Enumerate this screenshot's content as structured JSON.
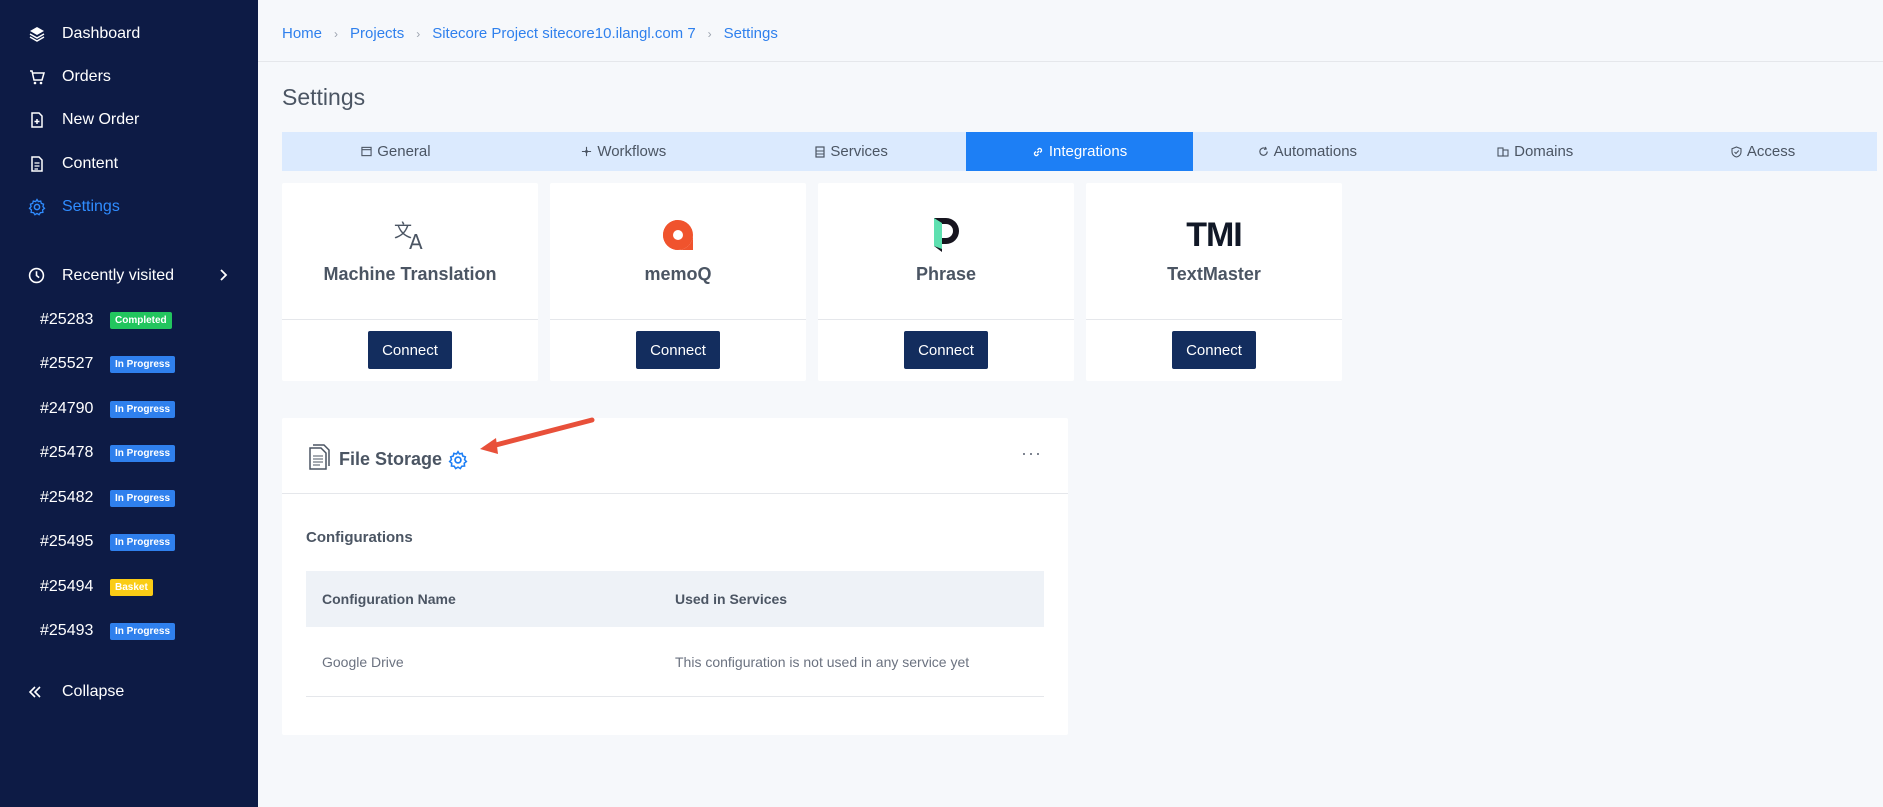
{
  "sidebar": {
    "nav": [
      {
        "label": "Dashboard",
        "icon": "layers-icon"
      },
      {
        "label": "Orders",
        "icon": "cart-icon"
      },
      {
        "label": "New Order",
        "icon": "new-document-icon"
      },
      {
        "label": "Content",
        "icon": "document-icon"
      },
      {
        "label": "Settings",
        "icon": "gear-icon"
      }
    ],
    "recent_label": "Recently visited",
    "recent": [
      {
        "num": "#25283",
        "status": "Completed"
      },
      {
        "num": "#25527",
        "status": "In Progress"
      },
      {
        "num": "#24790",
        "status": "In Progress"
      },
      {
        "num": "#25478",
        "status": "In Progress"
      },
      {
        "num": "#25482",
        "status": "In Progress"
      },
      {
        "num": "#25495",
        "status": "In Progress"
      },
      {
        "num": "#25494",
        "status": "Basket"
      },
      {
        "num": "#25493",
        "status": "In Progress"
      }
    ],
    "collapse_label": "Collapse"
  },
  "breadcrumb": [
    "Home",
    "Projects",
    "Sitecore Project sitecore10.ilangl.com 7",
    "Settings"
  ],
  "page_title": "Settings",
  "tabs": [
    {
      "label": "General",
      "icon": "window-icon"
    },
    {
      "label": "Workflows",
      "icon": "workflow-icon"
    },
    {
      "label": "Services",
      "icon": "server-icon"
    },
    {
      "label": "Integrations",
      "icon": "link-icon",
      "active": true
    },
    {
      "label": "Automations",
      "icon": "refresh-icon"
    },
    {
      "label": "Domains",
      "icon": "building-icon"
    },
    {
      "label": "Access",
      "icon": "shield-icon"
    }
  ],
  "integrations": [
    {
      "name": "Machine Translation",
      "button": "Connect",
      "logo": "translate-icon"
    },
    {
      "name": "memoQ",
      "button": "Connect",
      "logo": "memoq-logo"
    },
    {
      "name": "Phrase",
      "button": "Connect",
      "logo": "phrase-logo"
    },
    {
      "name": "TextMaster",
      "button": "Connect",
      "logo": "textmaster-logo",
      "logo_text": "TMI"
    }
  ],
  "file_storage": {
    "title": "File Storage",
    "subtitle": "Configurations",
    "columns": [
      "Configuration Name",
      "Used in Services"
    ],
    "rows": [
      {
        "name": "Google Drive",
        "used": "This configuration is not used in any service yet"
      }
    ]
  },
  "colors": {
    "sidebar_bg": "#0d1b45",
    "accent": "#1d7ff5",
    "button": "#132d5e",
    "annotation_arrow": "#e8503a"
  }
}
